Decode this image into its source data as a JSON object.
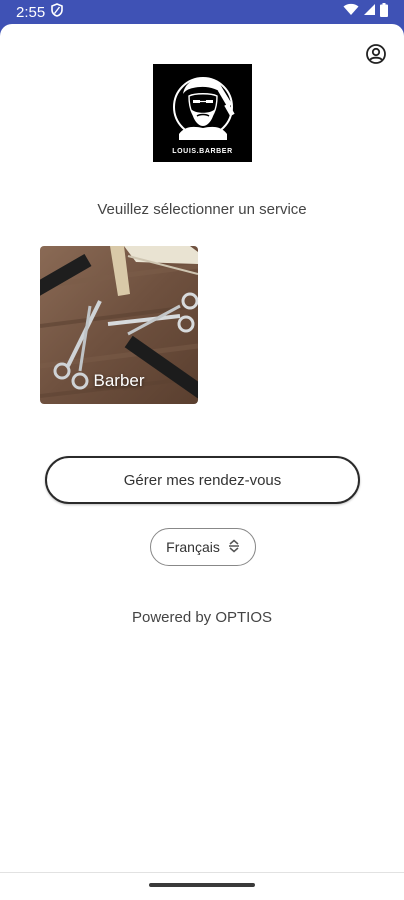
{
  "status_bar": {
    "time": "2:55",
    "icons": [
      "shield-icon",
      "wifi-icon",
      "signal-icon",
      "battery-icon"
    ]
  },
  "header": {
    "account_icon": "account-circle-icon",
    "logo_text": "LOUIS.BARBER"
  },
  "main": {
    "prompt": "Veuillez sélectionner un service",
    "services": [
      {
        "label": "Barber"
      }
    ],
    "manage_button": "Gérer mes rendez-vous",
    "language": {
      "selected": "Français",
      "icon": "unfold-icon"
    },
    "powered_by": "Powered by OPTIOS"
  },
  "colors": {
    "status_bar": "#3f52b5",
    "background": "#ffffff",
    "text": "#454545"
  }
}
